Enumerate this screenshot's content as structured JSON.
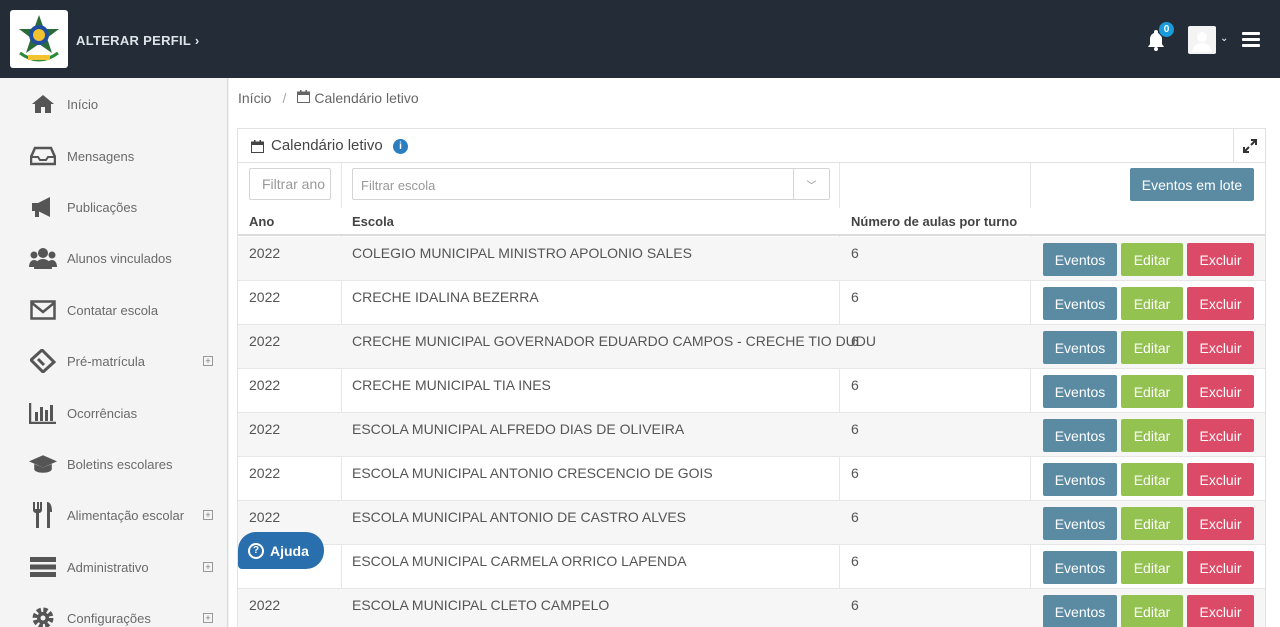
{
  "header": {
    "profile_link": "ALTERAR PERFIL",
    "profile_arrow": "›",
    "notifications_count": "0",
    "colors": {
      "topbar": "#242d37",
      "badge": "#1a9bdb"
    }
  },
  "sidebar": {
    "items": [
      {
        "label": "Início",
        "icon": "home-icon",
        "expandable": false
      },
      {
        "label": "Mensagens",
        "icon": "inbox-icon",
        "expandable": false
      },
      {
        "label": "Publicações",
        "icon": "megaphone-icon",
        "expandable": false
      },
      {
        "label": "Alunos vinculados",
        "icon": "users-icon",
        "expandable": false
      },
      {
        "label": "Contatar escola",
        "icon": "envelope-icon",
        "expandable": false
      },
      {
        "label": "Pré-matrícula",
        "icon": "ticket-icon",
        "expandable": true
      },
      {
        "label": "Ocorrências",
        "icon": "bar-chart-icon",
        "expandable": false
      },
      {
        "label": "Boletins escolares",
        "icon": "graduation-cap-icon",
        "expandable": false
      },
      {
        "label": "Alimentação escolar",
        "icon": "cutlery-icon",
        "expandable": true
      },
      {
        "label": "Administrativo",
        "icon": "server-icon",
        "expandable": true
      },
      {
        "label": "Configurações",
        "icon": "gear-icon",
        "expandable": true
      }
    ],
    "expand_symbol": "+"
  },
  "breadcrumb": {
    "home": "Início",
    "separator": "/",
    "current": "Calendário letivo"
  },
  "panel": {
    "title": "Calendário letivo",
    "info": "i"
  },
  "filters": {
    "ano_placeholder": "Filtrar ano",
    "escola_placeholder": "Filtrar escola",
    "lote_button": "Eventos em lote"
  },
  "table": {
    "headers": {
      "ano": "Ano",
      "escola": "Escola",
      "aulas": "Número de aulas por turno"
    },
    "actions": {
      "eventos": "Eventos",
      "editar": "Editar",
      "excluir": "Excluir"
    },
    "rows": [
      {
        "ano": "2022",
        "escola": "COLEGIO MUNICIPAL MINISTRO APOLONIO SALES",
        "aulas": "6"
      },
      {
        "ano": "2022",
        "escola": "CRECHE IDALINA BEZERRA",
        "aulas": "6"
      },
      {
        "ano": "2022",
        "escola": "CRECHE MUNICIPAL GOVERNADOR EDUARDO CAMPOS - CRECHE TIO DUDU",
        "aulas": "6"
      },
      {
        "ano": "2022",
        "escola": "CRECHE MUNICIPAL TIA INES",
        "aulas": "6"
      },
      {
        "ano": "2022",
        "escola": "ESCOLA MUNICIPAL ALFREDO DIAS DE OLIVEIRA",
        "aulas": "6"
      },
      {
        "ano": "2022",
        "escola": "ESCOLA MUNICIPAL ANTONIO CRESCENCIO DE GOIS",
        "aulas": "6"
      },
      {
        "ano": "2022",
        "escola": "ESCOLA MUNICIPAL ANTONIO DE CASTRO ALVES",
        "aulas": "6"
      },
      {
        "ano": "",
        "escola": "ESCOLA MUNICIPAL CARMELA ORRICO LAPENDA",
        "aulas": "6"
      },
      {
        "ano": "2022",
        "escola": "ESCOLA MUNICIPAL CLETO CAMPELO",
        "aulas": "6"
      }
    ]
  },
  "help": {
    "label": "Ajuda",
    "symbol": "?"
  }
}
